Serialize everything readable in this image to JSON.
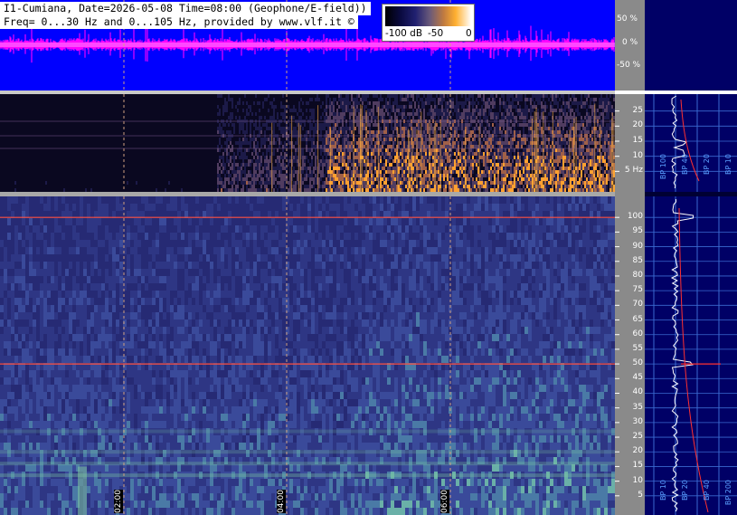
{
  "header": {
    "line1": "I1-Cumiana, Date=2026-05-08 Time=08:00 (Geophone/E-field))",
    "line2": "Freq= 0...30 Hz and 0...105 Hz, provided by www.vlf.it ©"
  },
  "colorbar": {
    "labels": [
      "-100 dB",
      "-50",
      "0"
    ]
  },
  "chart_data": [
    {
      "type": "line",
      "panel": "waveform",
      "yticks": [
        "50 %",
        "0 %",
        "-50 %"
      ],
      "ylim": [
        -100,
        100
      ],
      "series": [
        {
          "color": "#ff00ff"
        }
      ]
    },
    {
      "type": "heatmap",
      "panel": "spectrogram-0-30Hz",
      "ylim": [
        0,
        30
      ],
      "yticks": [
        "25",
        "20",
        "15",
        "10",
        "5 Hz"
      ],
      "ytick_values": [
        25,
        20,
        15,
        10,
        5
      ],
      "colormap": [
        "#000000",
        "#202070",
        "#c07a40",
        "#ffb030",
        "#ffffff"
      ]
    },
    {
      "type": "heatmap",
      "panel": "spectrogram-0-105Hz",
      "ylim": [
        0,
        105
      ],
      "yticks": [
        "100",
        "95",
        "90",
        "85",
        "80",
        "75",
        "70",
        "65",
        "60",
        "55",
        "50",
        "45",
        "40",
        "35",
        "30",
        "25",
        "20",
        "15",
        "10",
        "5"
      ],
      "ytick_values": [
        100,
        95,
        90,
        85,
        80,
        75,
        70,
        65,
        60,
        55,
        50,
        45,
        40,
        35,
        30,
        25,
        20,
        15,
        10,
        5
      ],
      "lines_hz": [
        50,
        100
      ],
      "colormap": [
        "#262a74",
        "#3a4a9a",
        "#4a8aa0",
        "#80c8a0"
      ]
    },
    {
      "type": "line",
      "panel": "average-spectrum",
      "bp_labels_top": [
        "BP 100",
        "BP 40",
        "BP 20",
        "BP 10"
      ],
      "bp_labels_bottom": [
        "BP 10",
        "BP 20",
        "BP 40",
        "BP 200"
      ]
    }
  ],
  "time_axis": {
    "labels": [
      "02:00",
      "04:00",
      "06:00"
    ]
  }
}
